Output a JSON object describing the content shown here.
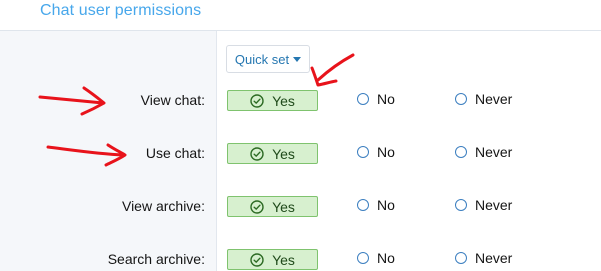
{
  "header": {
    "title": "Chat user permissions"
  },
  "quick_set": {
    "label": "Quick set"
  },
  "option_labels": {
    "yes": "Yes",
    "no": "No",
    "never": "Never"
  },
  "rows": [
    {
      "label": "View chat:"
    },
    {
      "label": "Use chat:"
    },
    {
      "label": "View archive:"
    },
    {
      "label": "Search archive:"
    }
  ],
  "selected_value": "Yes",
  "icons": {
    "selected": "check-circle-icon",
    "radio": "radio-empty-icon",
    "dropdown": "caret-down-icon"
  },
  "colors": {
    "title": "#47a7eb",
    "yes_bg": "#d7f0cf",
    "yes_border": "#7fc36e",
    "link": "#2577b1",
    "annotation": "#e8131b"
  }
}
